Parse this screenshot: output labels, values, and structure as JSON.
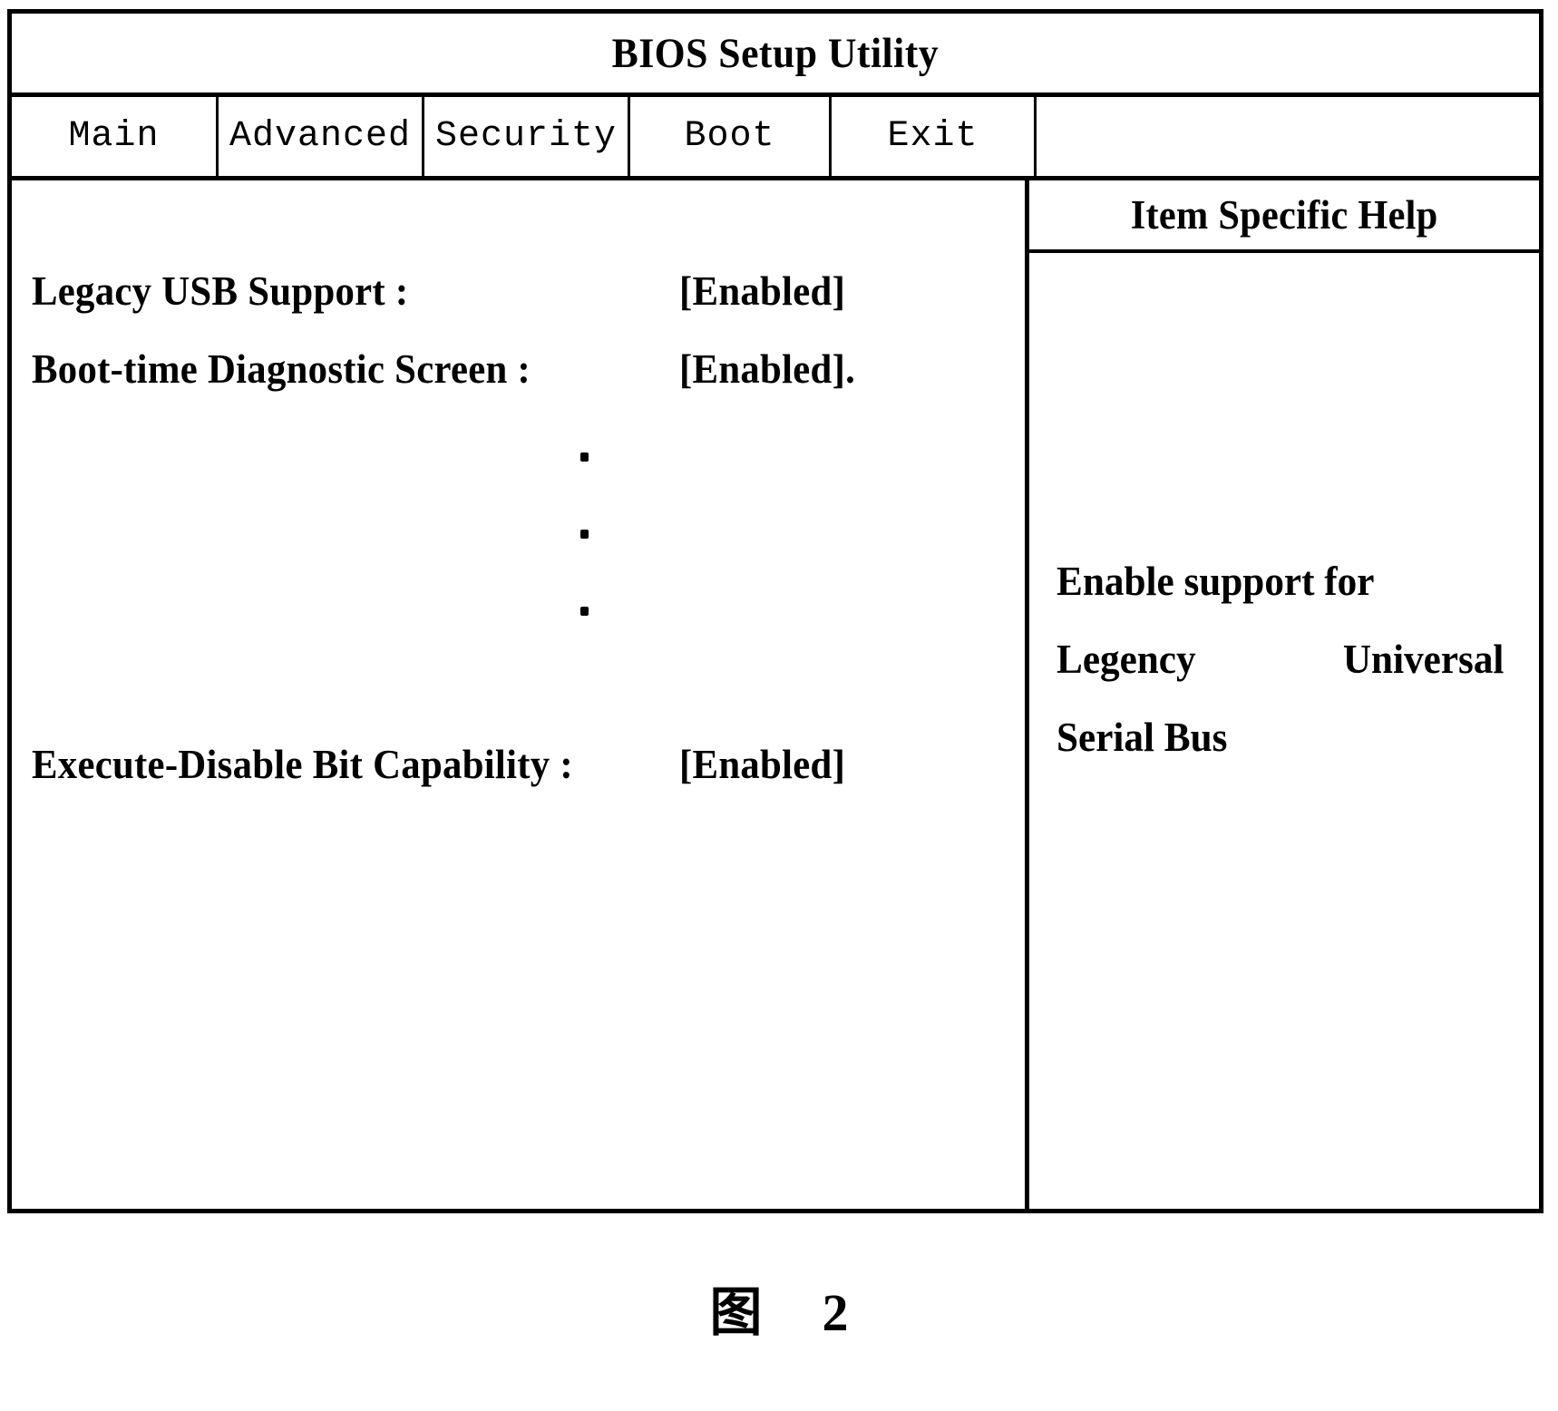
{
  "window": {
    "title": "BIOS Setup Utility"
  },
  "menu": {
    "tabs": [
      {
        "label": "Main",
        "selected": true
      },
      {
        "label": "Advanced",
        "selected": false
      },
      {
        "label": "Security",
        "selected": false
      },
      {
        "label": "Boot",
        "selected": false
      },
      {
        "label": "Exit",
        "selected": false
      }
    ]
  },
  "settings": {
    "rows": [
      {
        "label": "Legacy USB Support :",
        "value": "[Enabled]"
      },
      {
        "label": "Boot-time Diagnostic Screen :",
        "value": "[Enabled]."
      },
      {
        "label": "Execute-Disable Bit Capability :",
        "value": "[Enabled]"
      }
    ],
    "ellipsis": "⋮"
  },
  "help": {
    "header": "Item Specific Help",
    "lines": [
      {
        "left": "Enable support for",
        "right": ""
      },
      {
        "left": "Legency",
        "right": "Universal"
      },
      {
        "left": "Serial Bus",
        "right": ""
      }
    ]
  },
  "figure": {
    "label": "图",
    "number": "2"
  },
  "colors": {
    "border": "#000000",
    "background": "#ffffff",
    "text": "#000000"
  }
}
